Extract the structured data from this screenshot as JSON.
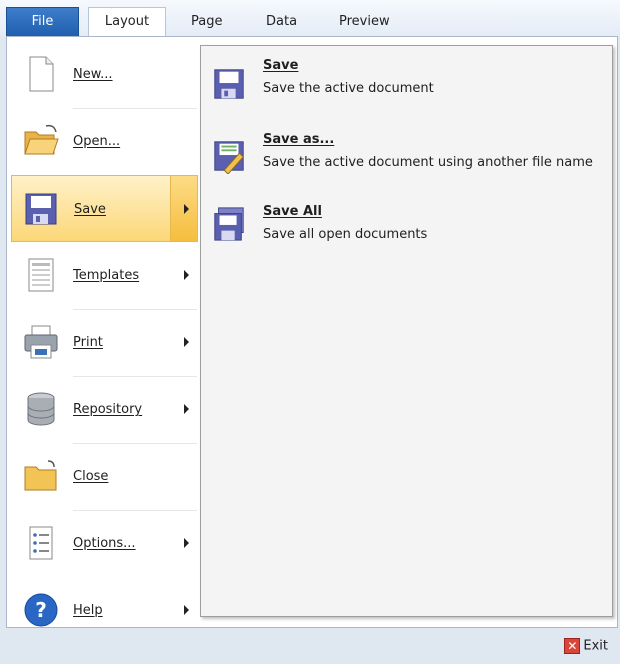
{
  "tabs": {
    "file": "File",
    "items": [
      "Layout",
      "Page",
      "Data",
      "Preview"
    ]
  },
  "menu": {
    "new": "New...",
    "open": "Open...",
    "save": "Save",
    "templates": "Templates",
    "print": "Print",
    "repository": "Repository",
    "close": "Close",
    "options": "Options...",
    "help": "Help"
  },
  "save_submenu": {
    "save": {
      "title": "Save",
      "desc": "Save the active document"
    },
    "save_as": {
      "title": "Save as...",
      "desc": "Save the active document using another file name"
    },
    "save_all": {
      "title": "Save All",
      "desc": "Save all open documents"
    }
  },
  "exit_label": "Exit",
  "colors": {
    "file_tab": "#2a6bbd",
    "selected_item": "#fbd777",
    "floppy": "#5a5fb0",
    "exit_icon": "#d9473a"
  }
}
